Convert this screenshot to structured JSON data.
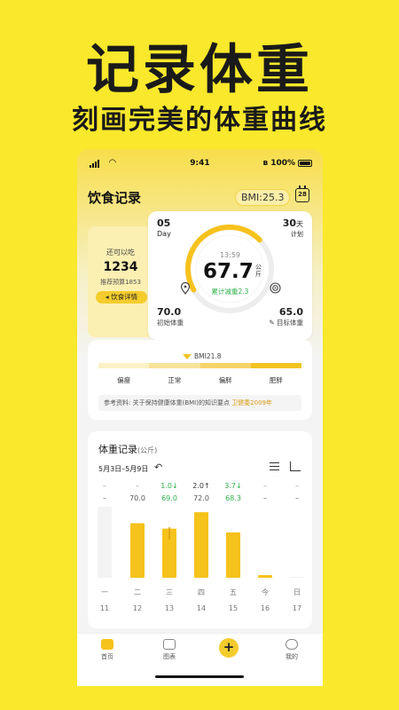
{
  "promo": {
    "title": "记录体重",
    "subtitle": "刻画完美的体重曲线"
  },
  "status_bar": {
    "time": "9:41",
    "battery": "100%"
  },
  "header": {
    "title": "饮食记录",
    "bmi": "BMI:25.3",
    "calendar_day": "28"
  },
  "food_card": {
    "label": "还可以吃",
    "value": "1234",
    "budget": "推荐预算1853",
    "button": "◂ 饮食详情"
  },
  "weight_card": {
    "day_num": "05",
    "day_label": "Day",
    "plan_num": "30",
    "plan_unit": "天",
    "plan_label": "计划",
    "time": "13:59",
    "weight": "67.7",
    "unit": "公斤",
    "cumulative": "累计减重2.3",
    "initial_value": "70.0",
    "initial_label": "初始体重",
    "target_value": "65.0",
    "target_label": "目标体重",
    "progress": 0.46
  },
  "bmi_card": {
    "marker": "BMI21.8",
    "segments": [
      "偏瘦",
      "正常",
      "偏胖",
      "肥胖"
    ],
    "segment_colors": [
      "#FBF1C6",
      "#F9E39A",
      "#F7D46A",
      "#F2C421"
    ],
    "reference": "参考资料: 关于保持健康体重(BMI)的知识要点",
    "reference_source": "卫健委2009年"
  },
  "record": {
    "title": "体重记录",
    "unit": "(公斤)",
    "range": "5月3日–5月9日",
    "accent": "#F6C21C"
  },
  "chart_data": {
    "type": "bar",
    "categories": [
      "一",
      "二",
      "三",
      "四",
      "五",
      "今",
      "日"
    ],
    "dates": [
      "11",
      "12",
      "13",
      "14",
      "15",
      "16",
      "17"
    ],
    "values": [
      null,
      70.0,
      69.0,
      72.0,
      68.3,
      null,
      null
    ],
    "value_labels": [
      "–",
      "70.0",
      "69.0",
      "72.0",
      "68.3",
      "–",
      "–"
    ],
    "change_labels": [
      "–",
      "–",
      "1.0↓",
      "2.0↑",
      "3.7↓",
      "–",
      "–"
    ],
    "change_colors": [
      "#999",
      "#999",
      "#2DB04A",
      "#333",
      "#2DB04A",
      "#999",
      "#999"
    ]
  },
  "tabbar": {
    "home": "首页",
    "chart": "图表",
    "add": "+",
    "me": "我的"
  }
}
